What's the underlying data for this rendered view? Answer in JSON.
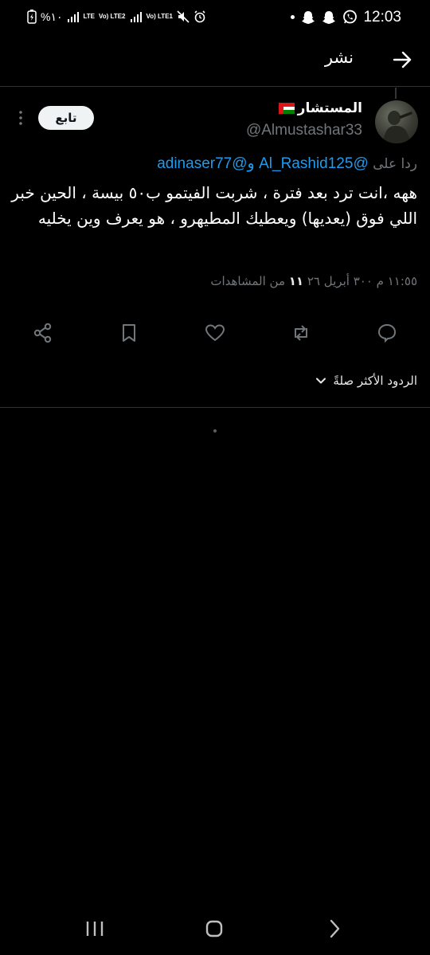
{
  "status_bar": {
    "time": "12:03",
    "battery": "%١٠",
    "left_icons": [
      "battery-icon",
      "signal-icon",
      "lte-icon",
      "volte-lte2-icon",
      "signal2-icon",
      "volte-lte1-icon",
      "mute-icon",
      "alarm-icon"
    ],
    "right_icons": [
      "dot-icon",
      "snapchat-icon",
      "snapchat-icon",
      "whatsapp-icon"
    ],
    "lte_label": "LTE",
    "lte2_label": "Vo) LTE2",
    "lte1_label": "Vo) LTE1"
  },
  "header": {
    "title": "نشر"
  },
  "tweet": {
    "display_name": "المستشار",
    "handle": "@Almustashar33",
    "follow_label": "تابع",
    "reply_prefix": "ردا على",
    "reply_user1": "@Al_Rashid125",
    "reply_and": "و",
    "reply_user2": "@adinaser77",
    "text": "ههه ،انت ترد بعد فترة ، شربت الفيتمو ب٥٠ بيسة ، الحين خبر اللي فوق (يعديها) ويعطيك المطيهرو ، هو يعرف وين يخليه",
    "time": "١١:٥٥ م",
    "date": "٣٠٠ أبريل ٢٦",
    "views_count": "١١",
    "views_label": "من المشاهدات"
  },
  "actions": [
    "reply-icon",
    "retweet-icon",
    "like-icon",
    "bookmark-icon",
    "share-icon"
  ],
  "replies_sort": {
    "label": "الردود الأكثر صلةً"
  },
  "colors": {
    "background": "#000000",
    "link": "#1d9bf0",
    "secondary": "#71767b",
    "divider": "#2f3336"
  }
}
